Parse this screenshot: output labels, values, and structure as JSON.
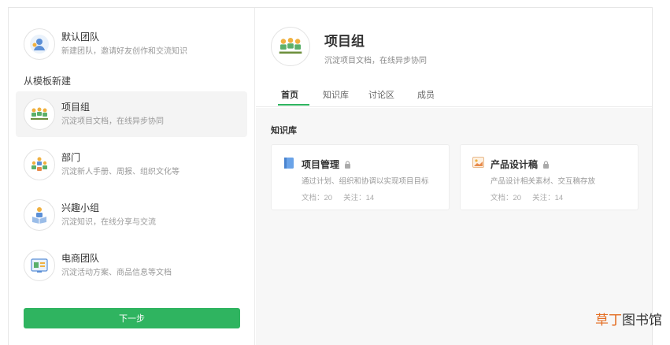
{
  "default_team": {
    "name": "默认团队",
    "desc": "新建团队，邀请好友创作和交流知识"
  },
  "template_section_label": "从模板新建",
  "templates": [
    {
      "name": "项目组",
      "desc": "沉淀项目文档，在线异步协同",
      "icon": "project-group-icon",
      "selected": true
    },
    {
      "name": "部门",
      "desc": "沉淀新人手册、周报、组织文化等",
      "icon": "department-icon",
      "selected": false
    },
    {
      "name": "兴趣小组",
      "desc": "沉淀知识，在线分享与交流",
      "icon": "interest-group-icon",
      "selected": false
    },
    {
      "name": "电商团队",
      "desc": "沉淀活动方案、商品信息等文档",
      "icon": "ecommerce-team-icon",
      "selected": false
    }
  ],
  "next_button": "下一步",
  "preview": {
    "title": "项目组",
    "subtitle": "沉淀项目文档，在线异步协同",
    "tabs": [
      "首页",
      "知识库",
      "讨论区",
      "成员"
    ],
    "active_tab": "首页",
    "section_label": "知识库",
    "cards": [
      {
        "title": "项目管理",
        "desc": "通过计划、组织和协调以实现项目目标",
        "docs": "文档：20",
        "follows": "关注：14",
        "icon": "book-icon"
      },
      {
        "title": "产品设计稿",
        "desc": "产品设计相关素材、交互稿存放",
        "docs": "文档：20",
        "follows": "关注：14",
        "icon": "image-icon"
      }
    ]
  },
  "watermark": {
    "part1": "草丁",
    "part2": "图书馆"
  },
  "colors": {
    "accent": "#2fb460",
    "selected_bg": "#f4f4f4",
    "content_bg": "#f7f7f7",
    "watermark_accent": "#e36a1d"
  }
}
